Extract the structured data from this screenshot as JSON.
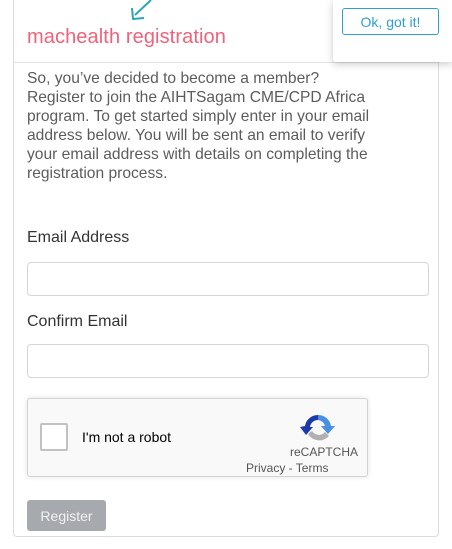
{
  "form": {
    "title": "machealth registration",
    "intro": "So, you’ve decided to become a member?\nRegister to join the AIHTSagam CME/CPD Africa\nprogram. To get started simply enter in your email\naddress below. You will be sent an email to verify\nyour email address with details on completing the\nregistration process.",
    "email_label": "Email Address",
    "email_value": "",
    "confirm_label": "Confirm Email",
    "confirm_value": "",
    "register_label": "Register"
  },
  "recaptcha": {
    "checkbox_label": "I'm not a robot",
    "brand": "reCAPTCHA",
    "privacy": "Privacy",
    "separator": " - ",
    "terms": "Terms",
    "logo_icon": "recaptcha-logo-icon"
  },
  "popover": {
    "button_label": "Ok, got it!"
  },
  "colors": {
    "title": "#f0627a",
    "accent": "#2e9fd3",
    "register_button": "#a6a9ad"
  },
  "icons": {
    "pointer": "arrow-pointer-icon"
  }
}
